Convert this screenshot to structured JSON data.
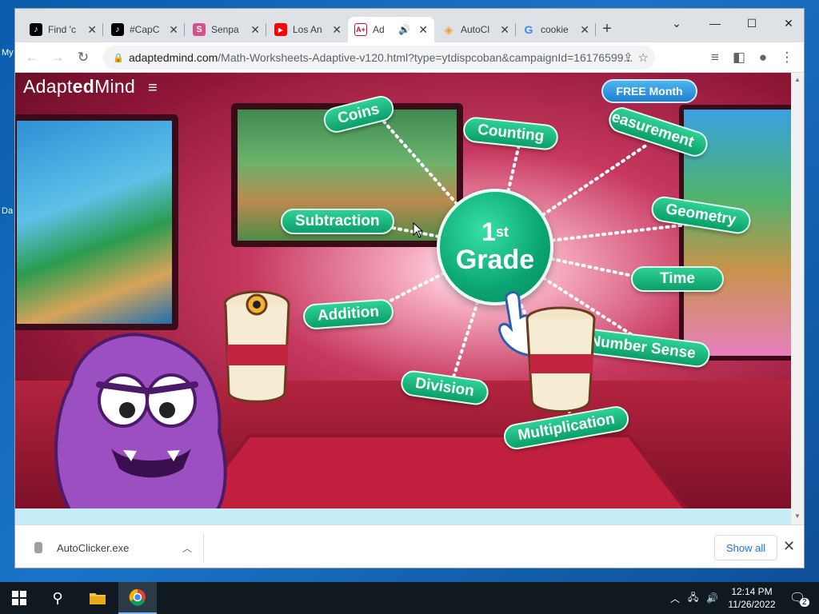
{
  "desktop": {
    "labels": [
      "My",
      "Da"
    ]
  },
  "browser": {
    "tabs": [
      {
        "label": "Find 'c",
        "icon": "tiktok-icon"
      },
      {
        "label": "#CapC",
        "icon": "tiktok-icon"
      },
      {
        "label": "Senpa",
        "icon": "senpai-icon"
      },
      {
        "label": "Los An",
        "icon": "youtube-icon"
      },
      {
        "label": "Ad",
        "icon": "adaptedmind-icon",
        "active": true,
        "audio": true
      },
      {
        "label": "AutoCl",
        "icon": "autoclicker-icon"
      },
      {
        "label": "cookie",
        "icon": "google-icon"
      }
    ],
    "address": {
      "host": "adaptedmind.com",
      "path": "/Math-Worksheets-Adaptive-v120.html?type=ytdispcoban&campaignId=16176599..."
    }
  },
  "page": {
    "logo_pre": "Adapt",
    "logo_bold": "ed",
    "logo_post": "Mind",
    "free_button": "FREE Month",
    "grade_number": "1",
    "grade_suffix": "st",
    "grade_word": "Grade",
    "topics": {
      "coins": "Coins",
      "counting": "Counting",
      "measurement": "Measurement",
      "subtraction": "Subtraction",
      "geometry": "Geometry",
      "time": "Time",
      "addition": "Addition",
      "number_sense": "Number Sense",
      "division": "Division",
      "multiplication": "Multiplication"
    }
  },
  "download_bar": {
    "file_name": "AutoClicker.exe",
    "show_all": "Show all"
  },
  "taskbar": {
    "time": "12:14 PM",
    "date": "11/26/2022",
    "notifications": "2"
  },
  "colors": {
    "accent_green": "#0b9e69",
    "page_red": "#c7385f",
    "link_blue": "#1a73e8"
  }
}
